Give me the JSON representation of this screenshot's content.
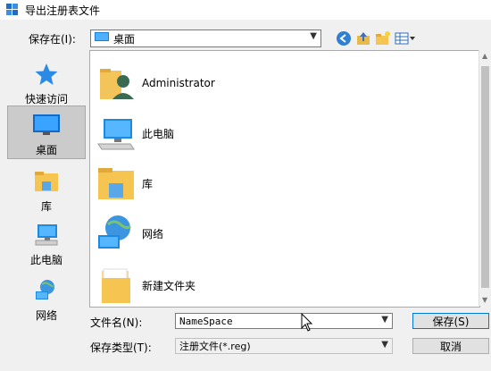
{
  "window": {
    "title": "导出注册表文件"
  },
  "save_in": {
    "label": "保存在(I):",
    "value": "桌面"
  },
  "places": [
    {
      "label": "快速访问",
      "icon": "star-icon"
    },
    {
      "label": "桌面",
      "icon": "desktop-icon",
      "selected": true
    },
    {
      "label": "库",
      "icon": "library-icon"
    },
    {
      "label": "此电脑",
      "icon": "computer-icon"
    },
    {
      "label": "网络",
      "icon": "network-icon"
    }
  ],
  "files": [
    {
      "name": "Administrator",
      "icon": "user-folder-icon"
    },
    {
      "name": "此电脑",
      "icon": "computer-icon"
    },
    {
      "name": "库",
      "icon": "library-icon"
    },
    {
      "name": "网络",
      "icon": "network-icon"
    },
    {
      "name": "新建文件夹",
      "icon": "folder-icon"
    }
  ],
  "filename": {
    "label": "文件名(N):",
    "value": "NameSpace"
  },
  "filetype": {
    "label": "保存类型(T):",
    "value": "注册文件(*.reg)"
  },
  "buttons": {
    "save": "保存(S)",
    "cancel": "取消"
  },
  "colors": {
    "accent": "#0078d7",
    "folder": "#f5c451",
    "selection": "#cbcbcb"
  }
}
